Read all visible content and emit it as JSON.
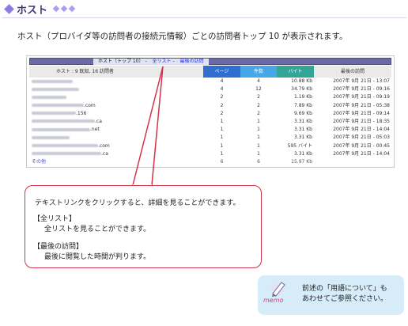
{
  "header": {
    "title": "ホスト",
    "intro": "ホスト（プロバイダ等の訪問者の接続元情報）ごとの訪問者トップ 10 が表示されます。"
  },
  "screenshot": {
    "bar_title": "ホスト（トップ 10）",
    "link_all": "全リスト",
    "link_last": "最後の訪問",
    "columns": {
      "host": "ホスト : 9 既知, 16 訪問者",
      "pages": "ページ",
      "hits": "件数",
      "bytes": "バイト",
      "last": "最後の訪問"
    },
    "rows": [
      {
        "host_suffix": "",
        "pages": "4",
        "hits": "4",
        "bytes": "10.88 Kb",
        "last": "2007年 9月 21日 - 13:07"
      },
      {
        "host_suffix": "",
        "pages": "4",
        "hits": "12",
        "bytes": "34.79 Kb",
        "last": "2007年 9月 21日 - 09:16"
      },
      {
        "host_suffix": "",
        "pages": "2",
        "hits": "2",
        "bytes": "1.19 Kb",
        "last": "2007年 9月 21日 - 09:19"
      },
      {
        "host_suffix": ".com",
        "pages": "2",
        "hits": "2",
        "bytes": "7.89 Kb",
        "last": "2007年 9月 21日 - 05:38"
      },
      {
        "host_suffix": ".156",
        "pages": "2",
        "hits": "2",
        "bytes": "9.69 Kb",
        "last": "2007年 9月 21日 - 09:14"
      },
      {
        "host_suffix": ".ca",
        "pages": "1",
        "hits": "1",
        "bytes": "3.31 Kb",
        "last": "2007年 9月 21日 - 18:35"
      },
      {
        "host_suffix": ".net",
        "pages": "1",
        "hits": "1",
        "bytes": "3.31 Kb",
        "last": "2007年 9月 21日 - 14:04"
      },
      {
        "host_suffix": "",
        "pages": "1",
        "hits": "1",
        "bytes": "3.31 Kb",
        "last": "2007年 9月 21日 - 05:03"
      },
      {
        "host_suffix": ".com",
        "pages": "1",
        "hits": "1",
        "bytes": "595 バイト",
        "last": "2007年 9月 21日 - 00:45"
      },
      {
        "host_suffix": ".ca",
        "pages": "1",
        "hits": "1",
        "bytes": "3.31 Kb",
        "last": "2007年 9月 21日 - 14:04"
      }
    ],
    "total": {
      "host": "その他",
      "pages": "6",
      "hits": "6",
      "bytes": "15.97 Kb",
      "last": ""
    }
  },
  "callout": {
    "lead": "テキストリンクをクリックすると、詳細を見ることができます。",
    "all_heading": "【全リスト】",
    "all_body": "全リストを見ることができます。",
    "last_heading": "【最後の訪問】",
    "last_body": "最後に閲覧した時間が判ります。"
  },
  "memo": {
    "label": "memo",
    "line1": "前述の「用語について」も",
    "line2": "あわせてご参照ください。"
  },
  "colors": {
    "pages_header": "#2f6fd0",
    "hits_header": "#45a7e8",
    "bytes_header": "#33a596",
    "callout_border": "#d2334a",
    "memo_bg": "#d6ecf9"
  }
}
